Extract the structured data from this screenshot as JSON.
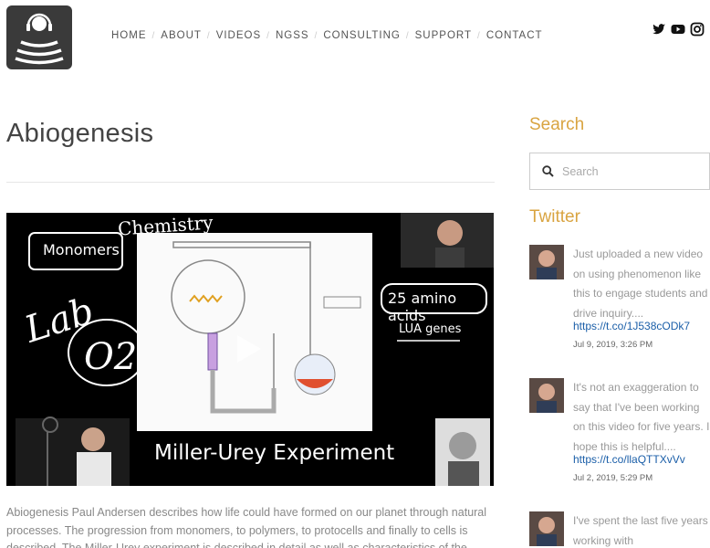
{
  "nav": {
    "items": [
      "HOME",
      "ABOUT",
      "VIDEOS",
      "NGSS",
      "CONSULTING",
      "SUPPORT",
      "CONTACT"
    ]
  },
  "social": [
    "twitter-icon",
    "youtube-icon",
    "instagram-icon"
  ],
  "page": {
    "title": "Abiogenesis",
    "description": "Abiogenesis Paul Andersen describes how life could have formed on our planet through natural processes. The progression from monomers, to polymers, to protocells and finally to cells is described. The Miller-Urey experiment is described in detail as well as characteristics of the latest"
  },
  "video": {
    "chemistry": "Chemistry",
    "monomers": "Monomers",
    "lab": "Lab",
    "o2": "O2",
    "amino": "25 amino acids",
    "lua": "LUA genes",
    "caption": "Miller-Urey Experiment"
  },
  "sidebar": {
    "search_heading": "Search",
    "search_placeholder": "Search",
    "twitter_heading": "Twitter",
    "tweets": [
      {
        "text": "Just uploaded a new video on using phenomenon like this to engage students and drive inquiry....",
        "link": "https://t.co/1J538cODk7",
        "date": "Jul 9, 2019, 3:26 PM"
      },
      {
        "text": "It's not an exaggeration to say that I've been working on this video for five years. I hope this is helpful....",
        "link": "https://t.co/llaQTTXvVv",
        "date": "Jul 2, 2019, 5:29 PM"
      },
      {
        "text": "I've spent the last five years working with",
        "link": "",
        "date": ""
      }
    ]
  },
  "colors": {
    "accent": "#d9a441",
    "link": "#1a5ea8",
    "logo_bg": "#3a3a3a"
  }
}
